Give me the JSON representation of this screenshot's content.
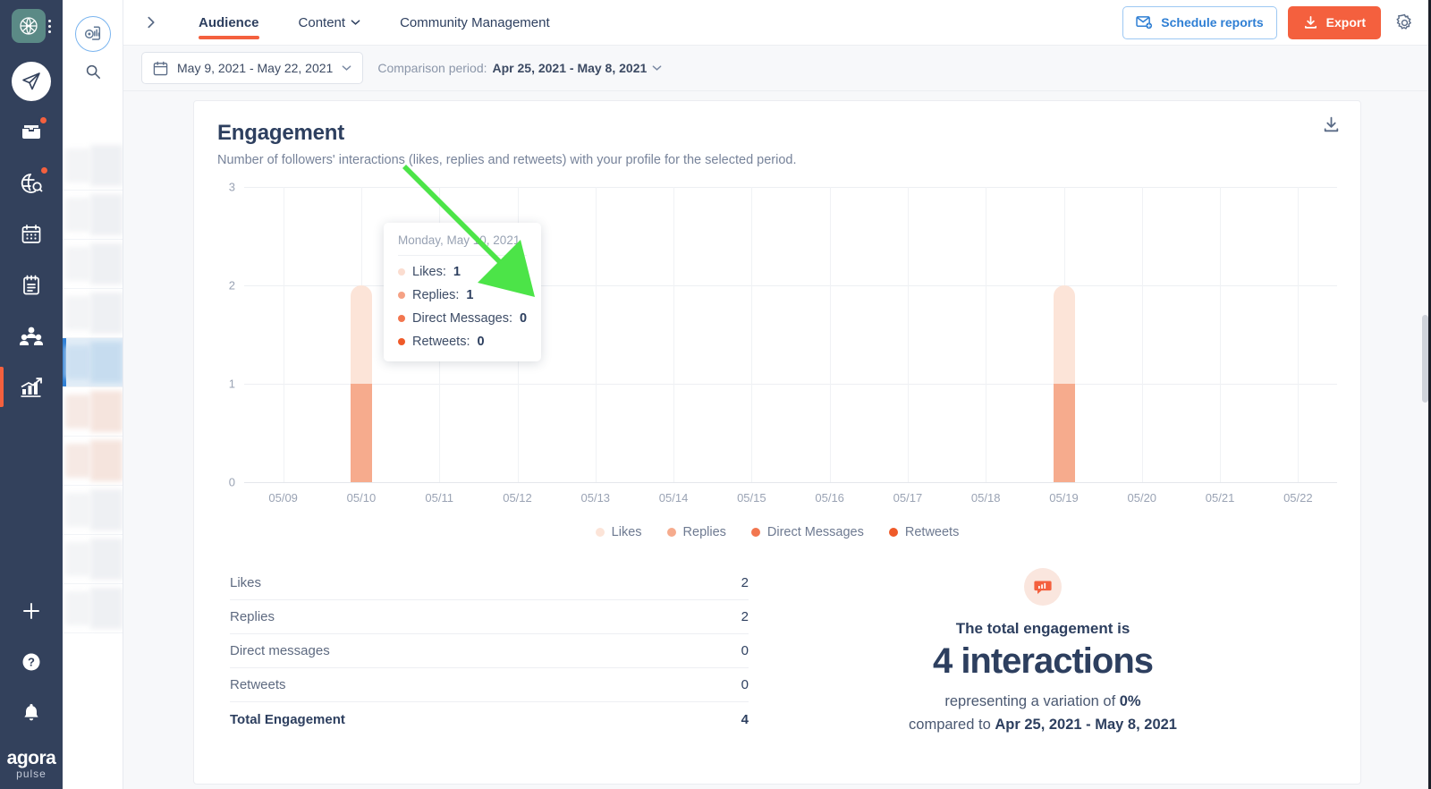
{
  "brand": {
    "name": "agora",
    "sub": "pulse"
  },
  "rail": {
    "items": [
      {
        "name": "compose-icon",
        "label": "Publishing"
      },
      {
        "name": "inbox-icon",
        "label": "Inbox",
        "badge": true
      },
      {
        "name": "listening-icon",
        "label": "Listening",
        "badge": true
      },
      {
        "name": "calendar-icon",
        "label": "Calendar"
      },
      {
        "name": "notes-icon",
        "label": "Notes"
      },
      {
        "name": "audience-icon",
        "label": "Audience"
      },
      {
        "name": "analytics-icon",
        "label": "Reports",
        "active": true
      }
    ],
    "bottom": [
      {
        "name": "plus-icon",
        "label": "Add"
      },
      {
        "name": "help-icon",
        "label": "Help"
      },
      {
        "name": "bell-icon",
        "label": "Notifications"
      }
    ]
  },
  "panel2": {
    "report_icon": "report-profile-icon",
    "search_icon": "search-icon"
  },
  "topbar": {
    "expand_icon": "chevron-right-icon",
    "tabs": [
      {
        "label": "Audience",
        "active": true,
        "caret": false
      },
      {
        "label": "Content",
        "active": false,
        "caret": true
      },
      {
        "label": "Community Management",
        "active": false,
        "caret": false
      }
    ],
    "schedule_label": "Schedule reports",
    "export_label": "Export",
    "gear_icon": "gear-icon",
    "accent_blue": "#2f7fd4",
    "accent_orange": "#f4603e"
  },
  "filters": {
    "date_range": "May 9, 2021 - May 22, 2021",
    "calendar_icon": "calendar-icon",
    "comparison_prefix": "Comparison period:",
    "comparison_value": "Apr 25, 2021 - May 8, 2021"
  },
  "card": {
    "title": "Engagement",
    "subtitle": "Number of followers' interactions (likes, replies and retweets) with your profile for the selected period.",
    "download_icon": "download-icon"
  },
  "tooltip": {
    "date": "Monday, May 10, 2021",
    "rows": [
      {
        "label": "Likes:",
        "value": "1",
        "color": "#fbddd0"
      },
      {
        "label": "Replies:",
        "value": "1",
        "color": "#f5a184"
      },
      {
        "label": "Direct Messages:",
        "value": "0",
        "color": "#f2764f"
      },
      {
        "label": "Retweets:",
        "value": "0",
        "color": "#ef5a29"
      }
    ]
  },
  "chart_data": {
    "type": "bar",
    "title": "Engagement",
    "stacked": true,
    "xlabel": "",
    "ylabel": "",
    "ylim": [
      0,
      3
    ],
    "yticks": [
      "0",
      "1",
      "2",
      "3"
    ],
    "grid": true,
    "legend_position": "bottom",
    "categories": [
      "05/09",
      "05/10",
      "05/11",
      "05/12",
      "05/13",
      "05/14",
      "05/15",
      "05/16",
      "05/17",
      "05/18",
      "05/19",
      "05/20",
      "05/21",
      "05/22"
    ],
    "series": [
      {
        "name": "Retweets",
        "color": "#ef5a29",
        "values": [
          0,
          0,
          0,
          0,
          0,
          0,
          0,
          0,
          0,
          0,
          0,
          0,
          0,
          0
        ]
      },
      {
        "name": "Direct Messages",
        "color": "#f2764f",
        "values": [
          0,
          0,
          0,
          0,
          0,
          0,
          0,
          0,
          0,
          0,
          0,
          0,
          0,
          0
        ]
      },
      {
        "name": "Replies",
        "color": "#f6ab8d",
        "values": [
          0,
          1,
          0,
          0,
          0,
          0,
          0,
          0,
          0,
          0,
          1,
          0,
          0,
          0
        ]
      },
      {
        "name": "Likes",
        "color": "#fce4d8",
        "values": [
          0,
          1,
          0,
          0,
          0,
          0,
          0,
          0,
          0,
          0,
          1,
          0,
          0,
          0
        ]
      }
    ]
  },
  "table": {
    "rows": [
      {
        "label": "Likes",
        "value": "2"
      },
      {
        "label": "Replies",
        "value": "2"
      },
      {
        "label": "Direct messages",
        "value": "0"
      },
      {
        "label": "Retweets",
        "value": "0"
      }
    ],
    "total": {
      "label": "Total Engagement",
      "value": "4"
    }
  },
  "summary": {
    "icon": "chat-chart-icon",
    "line1": "The total engagement is",
    "big": "4 interactions",
    "line3_pre": "representing a variation of ",
    "line3_value": "0%",
    "line4_pre": "compared to ",
    "line4_value": "Apr 25, 2021 - May 8, 2021"
  }
}
